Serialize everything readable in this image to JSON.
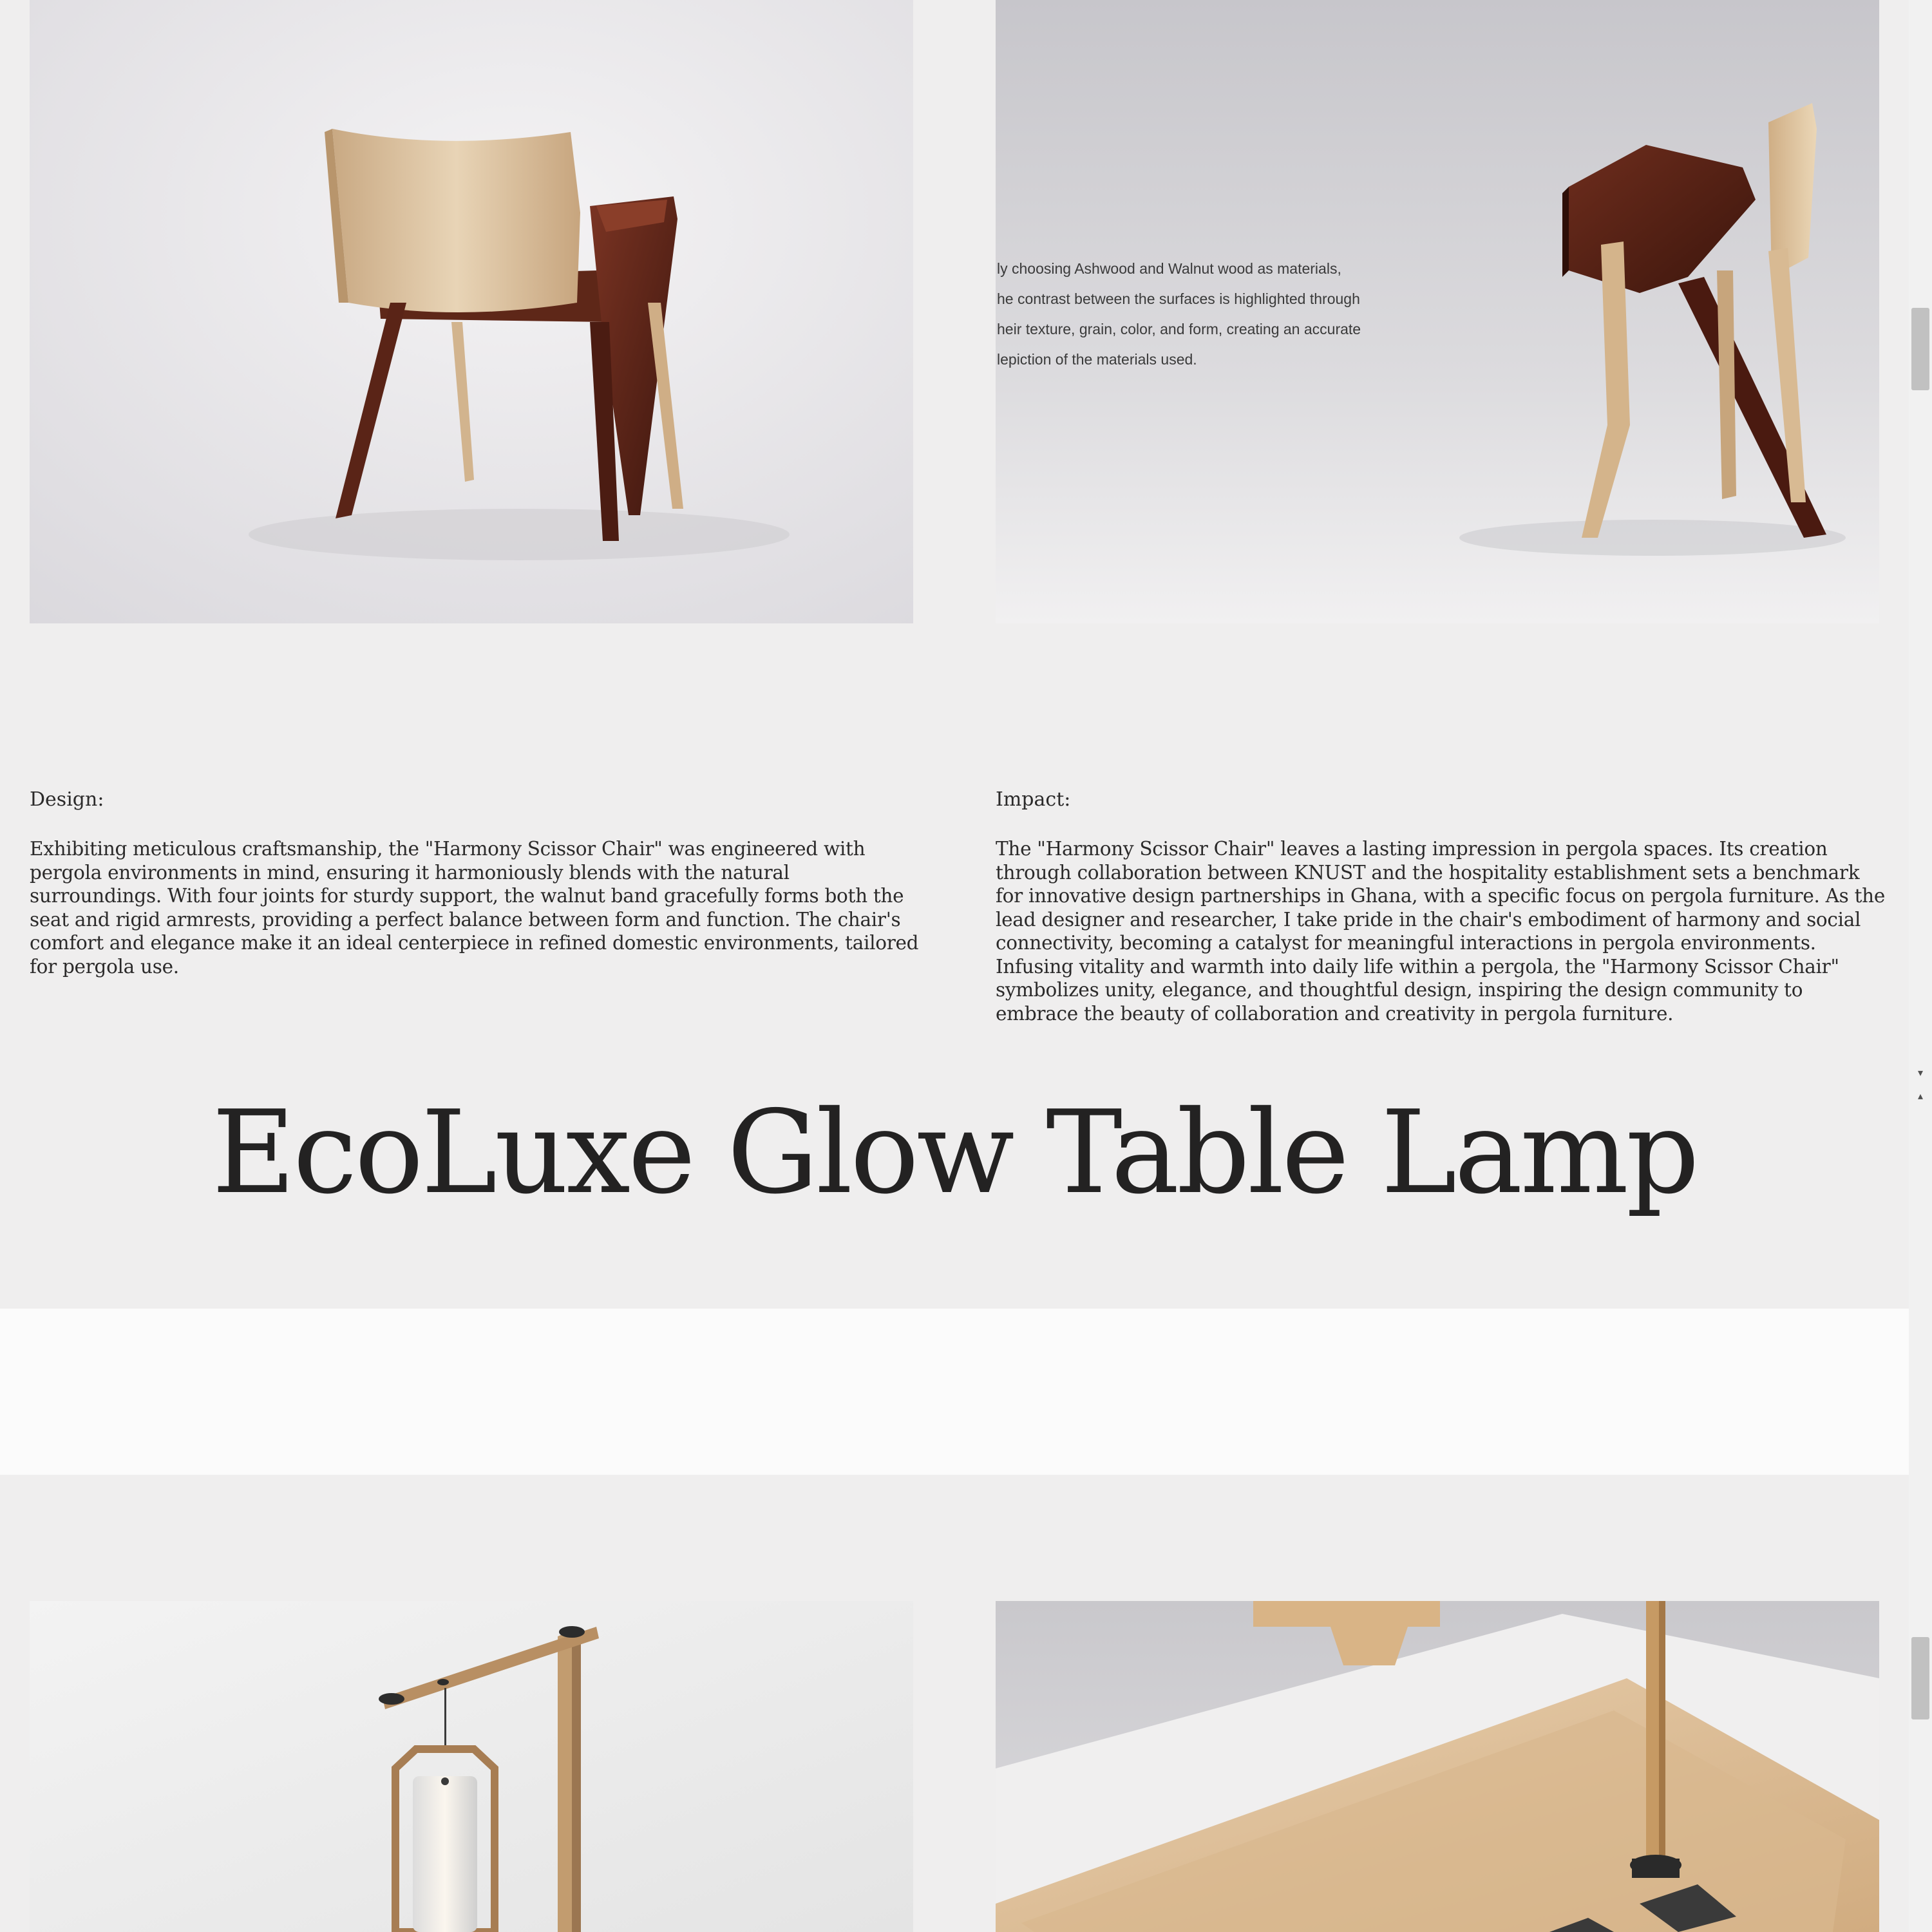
{
  "overlay": {
    "materials_text": "ly choosing Ashwood and Walnut wood as materials,\nhe contrast between the surfaces is highlighted through\nheir texture, grain, color, and form, creating an accurate\nlepiction of the materials used."
  },
  "design": {
    "heading": "Design:",
    "body": "Exhibiting meticulous craftsmanship, the \"Harmony Scissor Chair\" was engineered with pergola environments in mind, ensuring it harmoniously blends with the natural surroundings. With four joints for sturdy support, the walnut band gracefully forms both the seat and rigid armrests, providing a perfect balance between form and function. The chair's comfort and elegance make it an ideal centerpiece in refined domestic environments, tailored for pergola use."
  },
  "impact": {
    "heading": "Impact:",
    "body": "The \"Harmony Scissor Chair\" leaves a lasting impression in pergola spaces. Its creation through collaboration between KNUST and the hospitality establishment sets a benchmark for innovative design partnerships in Ghana, with a specific focus on pergola furniture. As the lead designer and researcher, I take pride in the chair's embodiment of harmony and social connectivity, becoming a catalyst for meaningful interactions in pergola environments. Infusing vitality and warmth into daily life within a pergola, the \"Harmony Scissor Chair\" symbolizes unity, elegance, and thoughtful design, inspiring the design community to embrace the beauty of collaboration and creativity in pergola furniture."
  },
  "section": {
    "title": "EcoLuxe Glow Table Lamp"
  },
  "scrollbar": {
    "up_icon": "triangle-up-icon",
    "down_icon": "triangle-down-icon"
  },
  "colors": {
    "page_bg": "#efeeee",
    "walnut": "#5a2a1c",
    "ashwood": "#d6b690",
    "text": "#2b2a2a"
  }
}
